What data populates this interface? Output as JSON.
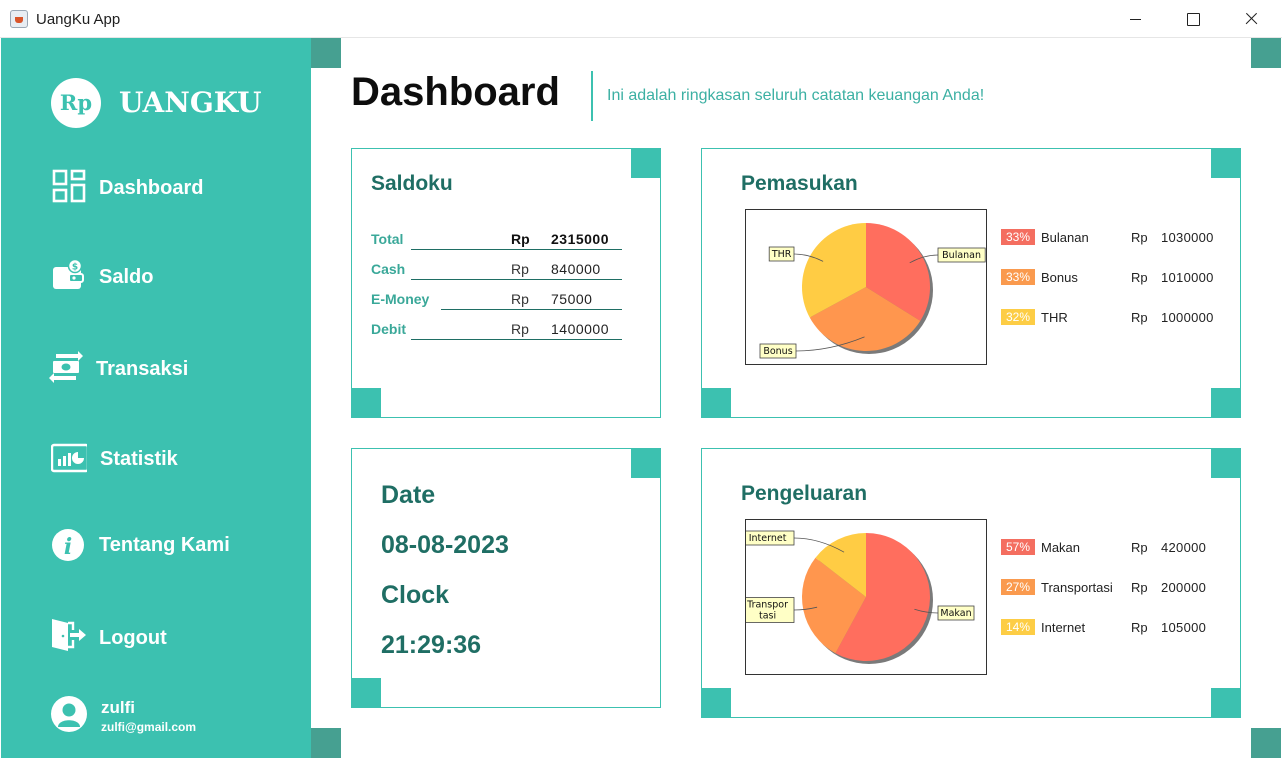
{
  "window": {
    "title": "UangKu App"
  },
  "sidebar": {
    "logo_mark": "Rp",
    "logo_text": "UANGKU",
    "items": [
      {
        "label": "Dashboard",
        "icon": "grid-icon"
      },
      {
        "label": "Saldo",
        "icon": "wallet-icon"
      },
      {
        "label": "Transaksi",
        "icon": "transfer-icon"
      },
      {
        "label": "Statistik",
        "icon": "chart-icon"
      },
      {
        "label": "Tentang Kami",
        "icon": "info-icon"
      },
      {
        "label": "Logout",
        "icon": "logout-icon"
      }
    ],
    "user": {
      "name": "zulfi",
      "email": "zulfi@gmail.com"
    }
  },
  "header": {
    "title": "Dashboard",
    "subtitle": "Ini adalah ringkasan seluruh catatan keuangan Anda!"
  },
  "saldoku": {
    "title": "Saldoku",
    "rows": [
      {
        "label": "Total",
        "currency": "Rp",
        "value": "2315000"
      },
      {
        "label": "Cash",
        "currency": "Rp",
        "value": "840000"
      },
      {
        "label": "E-Money",
        "currency": "Rp",
        "value": "75000"
      },
      {
        "label": "Debit",
        "currency": "Rp",
        "value": "1400000"
      }
    ]
  },
  "datetime": {
    "date_label": "Date",
    "date_value": "08-08-2023",
    "clock_label": "Clock",
    "clock_value": "21:29:36"
  },
  "pemasukan": {
    "title": "Pemasukan",
    "legend": [
      {
        "pct": "33%",
        "name": "Bulanan",
        "currency": "Rp",
        "value": "1030000",
        "color": "#f46e60"
      },
      {
        "pct": "33%",
        "name": "Bonus",
        "currency": "Rp",
        "value": "1010000",
        "color": "#fa9a4e"
      },
      {
        "pct": "32%",
        "name": "THR",
        "currency": "Rp",
        "value": "1000000",
        "color": "#fdcd45"
      }
    ],
    "chart_data": {
      "type": "pie",
      "slices": [
        {
          "name": "Bulanan",
          "value": 1030000,
          "color": "#ff6e5e"
        },
        {
          "name": "Bonus",
          "value": 1010000,
          "color": "#ff964e"
        },
        {
          "name": "THR",
          "value": 1000000,
          "color": "#ffcc44"
        }
      ]
    }
  },
  "pengeluaran": {
    "title": "Pengeluaran",
    "legend": [
      {
        "pct": "57%",
        "name": "Makan",
        "currency": "Rp",
        "value": "420000",
        "color": "#f46e60"
      },
      {
        "pct": "27%",
        "name": "Transportasi",
        "currency": "Rp",
        "value": "200000",
        "color": "#fa9a4e"
      },
      {
        "pct": "14%",
        "name": "Internet",
        "currency": "Rp",
        "value": "105000",
        "color": "#fdcd45"
      }
    ],
    "chart_data": {
      "type": "pie",
      "slices": [
        {
          "name": "Makan",
          "value": 420000,
          "color": "#ff6e5e"
        },
        {
          "name": "Transportasi",
          "value": 200000,
          "label_lines": [
            "Transpor",
            "tasi"
          ],
          "color": "#ff964e"
        },
        {
          "name": "Internet",
          "value": 105000,
          "color": "#ffcc44"
        }
      ]
    }
  },
  "colors": {
    "accent": "#3cc1b0",
    "accent_dark": "#1f6e64",
    "corner_dark": "#46a091"
  }
}
